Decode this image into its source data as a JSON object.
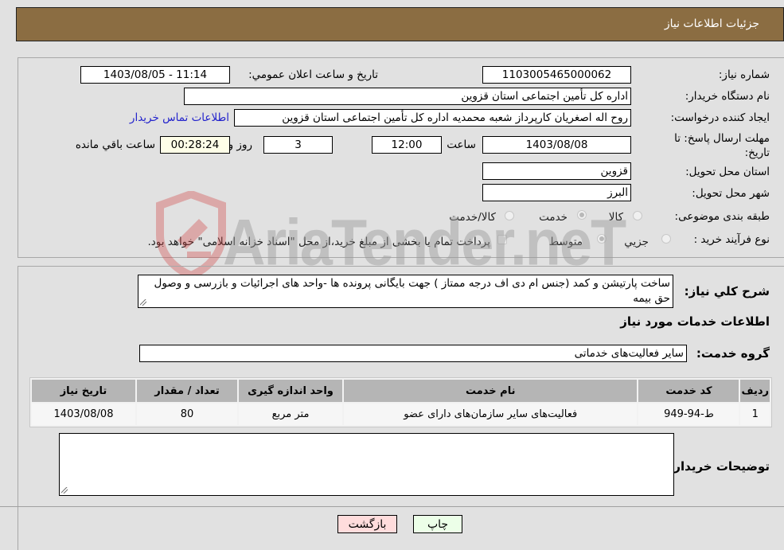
{
  "header": {
    "title": "جزئيات اطلاعات نياز"
  },
  "form": {
    "need_number_label": "شماره نياز:",
    "need_number": "1103005465000062",
    "announce_label": "تاريخ و ساعت اعلان عمومي:",
    "announce_value": "1403/08/05 - 11:14",
    "buyer_org_label": "نام دستگاه خريدار:",
    "buyer_org": "اداره کل تأمین اجتماعی استان قزوین",
    "requester_label": "ايجاد کننده درخواست:",
    "requester": "روح اله اصغریان کارپرداز شعبه محمدیه  اداره کل تأمین اجتماعی استان قزوین",
    "contact_link": "اطلاعات تماس خريدار",
    "deadline_label": "مهلت ارسال پاسخ: تا تاريخ:",
    "deadline_date": "1403/08/08",
    "time_label": "ساعت",
    "deadline_time": "12:00",
    "days_value": "3",
    "days_label": "روز و",
    "remaining_time": "00:28:24",
    "remaining_label": "ساعت باقي مانده",
    "province_label": "استان محل تحويل:",
    "province": "قزوين",
    "city_label": "شهر محل تحويل:",
    "city": "البرز",
    "category_label": "طبقه بندی موضوعی:",
    "category_options": [
      "کالا",
      "خدمت",
      "کالا/خدمت"
    ],
    "category_selected": "خدمت",
    "process_label": "نوع فرآيند خريد :",
    "process_options": [
      "جزيي",
      "متوسط"
    ],
    "process_selected": "متوسط",
    "treasury_note": "پرداخت تمام يا بخشی از مبلغ خريد،از محل \"اسناد خزانه اسلامی\" خواهد بود."
  },
  "details": {
    "description_label": "شرح کلي نياز:",
    "description": "ساخت پارتیشن و کمد (جنس ام دی اف درجه ممتاز ) جهت بایگانی پرونده ها -واحد های اجرائیات و بازرسی و وصول حق بیمه",
    "services_heading": "اطلاعات خدمات مورد نياز",
    "service_group_label": "گروه خدمت:",
    "service_group": "ساير فعاليت‌های خدماتی",
    "table": {
      "headers": [
        "رديف",
        "کد خدمت",
        "نام خدمت",
        "واحد اندازه گيری",
        "تعداد / مقدار",
        "تاريخ نياز"
      ],
      "rows": [
        [
          "1",
          "ط-94-949",
          "فعاليت‌های ساير سازمان‌های دارای عضو",
          "متر مربع",
          "80",
          "1403/08/08"
        ]
      ]
    },
    "buyer_notes_label": "توضيحات خريدار:",
    "buyer_notes": ""
  },
  "buttons": {
    "print": "چاپ",
    "back": "بازگشت"
  },
  "watermark": {
    "text": "AriaTender.neT"
  },
  "colors": {
    "header_bg": "#8b6d42",
    "link": "#2222cc",
    "back_btn": "#ffdcdc",
    "print_btn": "#ecffe8",
    "remaining_bg": "#fefee8"
  }
}
